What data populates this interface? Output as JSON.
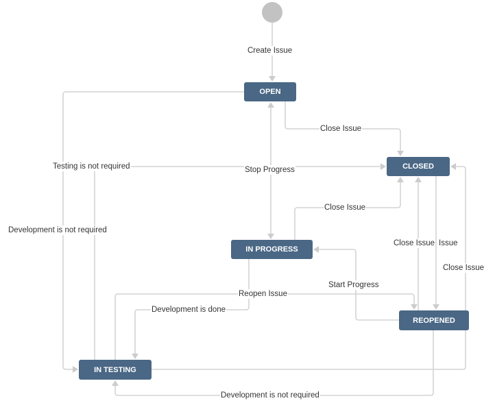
{
  "diagram": {
    "type": "workflow",
    "colors": {
      "status_node": "#4a6785",
      "start_node": "#c2c2c2",
      "edge": "#d4d4d4",
      "label_text": "#333333"
    },
    "statuses": {
      "open": "OPEN",
      "closed": "CLOSED",
      "in_progress": "IN PROGRESS",
      "reopened": "REOPENED",
      "in_testing": "IN TESTING"
    },
    "transitions": {
      "create_issue": "Create Issue",
      "close_issue_open": "Close Issue",
      "testing_not_required": "Testing is not required",
      "stop_progress": "Stop Progress",
      "development_not_required_left": "Development is not required",
      "close_issue_in_progress": "Close Issue",
      "close_issue_reopened": "Close Issue",
      "close_issue_dup": "Issue",
      "close_issue_right": "Close Issue",
      "start_progress": "Start Progress",
      "reopen_issue": "Reopen Issue",
      "development_done": "Development is done",
      "development_not_required_bottom": "Development is not required"
    },
    "edges": [
      {
        "from": "start",
        "to": "OPEN",
        "label": "Create Issue"
      },
      {
        "from": "OPEN",
        "to": "CLOSED",
        "label": "Close Issue"
      },
      {
        "from": "IN TESTING",
        "to": "CLOSED",
        "label": "Testing is not required"
      },
      {
        "from": "IN PROGRESS",
        "to": "OPEN",
        "label": "Stop Progress"
      },
      {
        "from": "OPEN",
        "to": "IN PROGRESS",
        "label": "Start Progress"
      },
      {
        "from": "OPEN",
        "to": "IN TESTING",
        "label": "Development is not required"
      },
      {
        "from": "IN PROGRESS",
        "to": "CLOSED",
        "label": "Close Issue"
      },
      {
        "from": "REOPENED",
        "to": "CLOSED",
        "label": "Close Issue"
      },
      {
        "from": "CLOSED",
        "to": "REOPENED",
        "label": "Reopen Issue"
      },
      {
        "from": "IN TESTING",
        "to": "CLOSED",
        "label": "Close Issue"
      },
      {
        "from": "REOPENED",
        "to": "IN PROGRESS",
        "label": "Start Progress"
      },
      {
        "from": "IN TESTING",
        "to": "REOPENED",
        "label": "Reopen Issue"
      },
      {
        "from": "IN PROGRESS",
        "to": "IN TESTING",
        "label": "Development is done"
      },
      {
        "from": "REOPENED",
        "to": "IN TESTING",
        "label": "Development is not required"
      }
    ]
  }
}
